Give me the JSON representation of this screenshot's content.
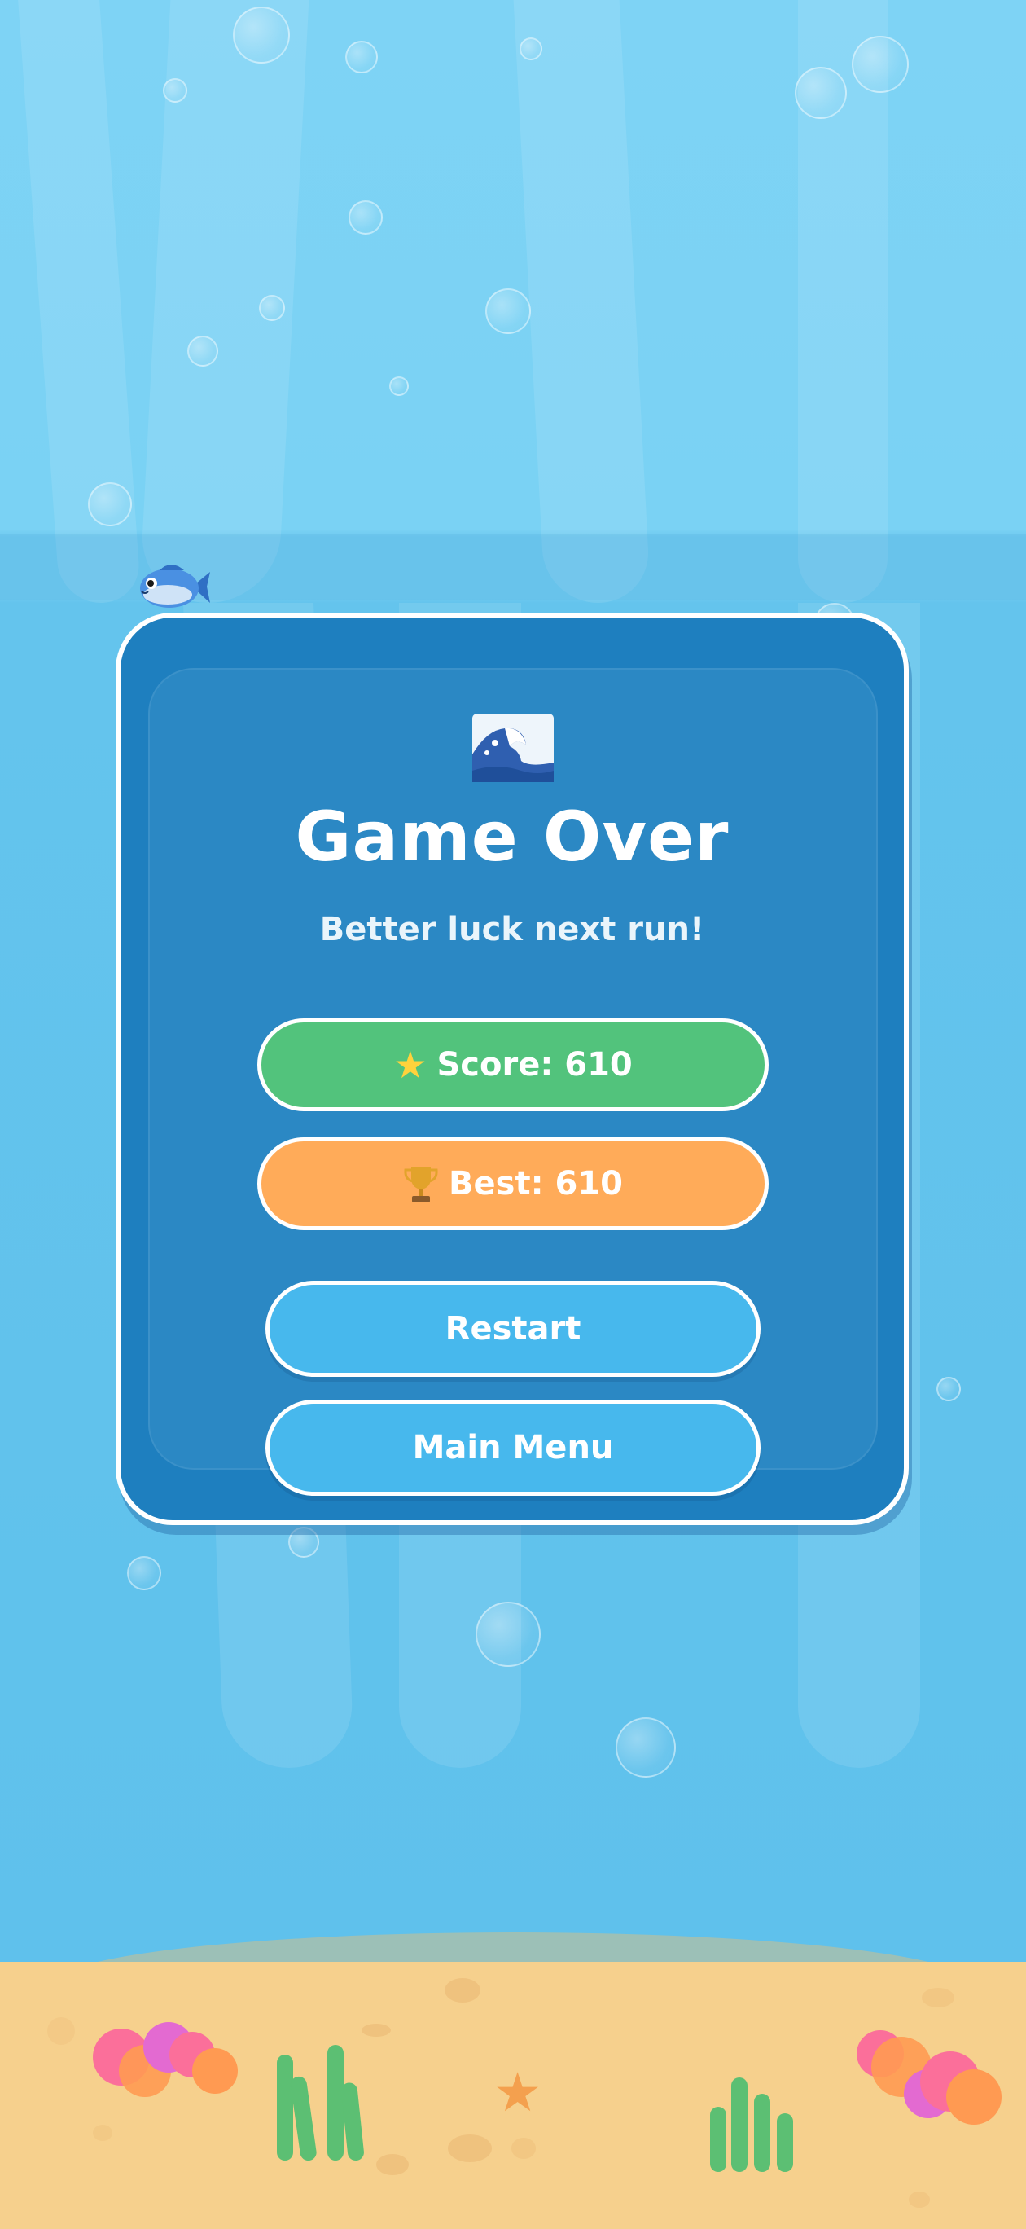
{
  "game": {
    "title": "Game Over",
    "subtitle": "Better luck next run!",
    "score_icon": "star-emoji",
    "score_label": "Score: 610",
    "best_icon": "trophy-emoji",
    "best_label": "Best: 610",
    "buttons": {
      "restart": "Restart",
      "main_menu": "Main Menu"
    },
    "header_icon": "wave-emoji",
    "score": 610,
    "best": 610
  },
  "colors": {
    "water": "#6cc8ef",
    "card": "#1e7fbf",
    "score_pill": "#52c37c",
    "best_pill": "#ffab59",
    "button": "#47b8ed",
    "sand": "#f6d08d"
  }
}
